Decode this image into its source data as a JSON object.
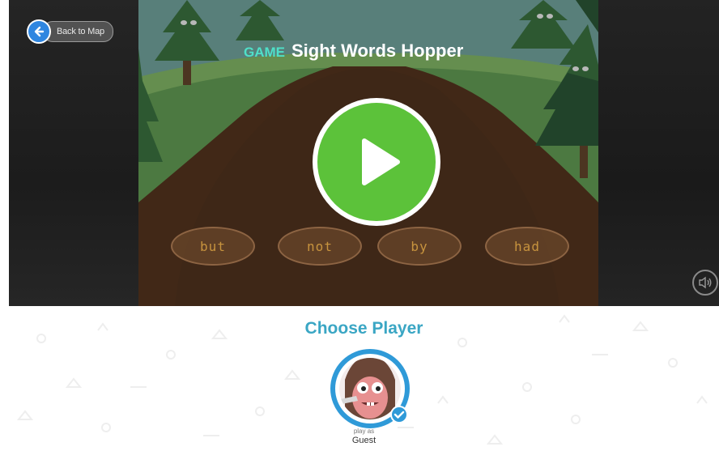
{
  "back_button": {
    "label": "Back to Map",
    "icon": "arrow-left-icon"
  },
  "game": {
    "tag": "GAME",
    "title": "Sight Words Hopper",
    "words": [
      "but",
      "not",
      "by",
      "had"
    ]
  },
  "sound": {
    "icon": "speaker-icon"
  },
  "player": {
    "heading": "Choose Player",
    "play_as": "play as",
    "name": "Guest"
  },
  "colors": {
    "play_green": "#5cc23a",
    "accent_teal": "#4fe0c8",
    "heading_blue": "#3aa6c4",
    "avatar_ring": "#2f9ad8"
  }
}
